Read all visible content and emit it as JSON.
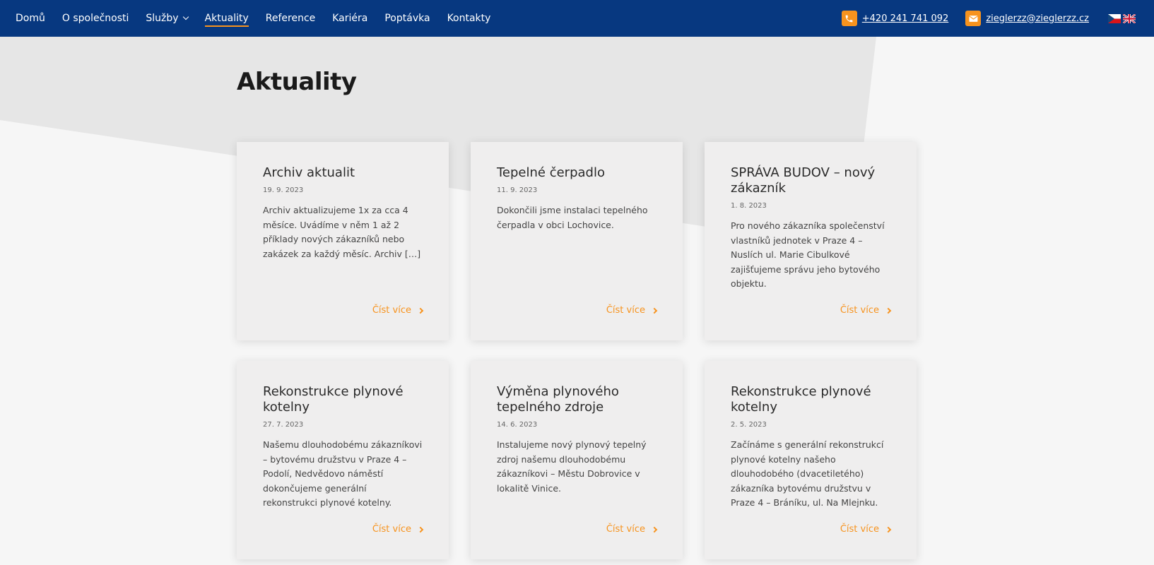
{
  "nav": {
    "items": [
      {
        "label": "Domů",
        "active": false,
        "dropdown": false
      },
      {
        "label": "O společnosti",
        "active": false,
        "dropdown": false
      },
      {
        "label": "Služby",
        "active": false,
        "dropdown": true
      },
      {
        "label": "Aktuality",
        "active": true,
        "dropdown": false
      },
      {
        "label": "Reference",
        "active": false,
        "dropdown": false
      },
      {
        "label": "Kariéra",
        "active": false,
        "dropdown": false
      },
      {
        "label": "Poptávka",
        "active": false,
        "dropdown": false
      },
      {
        "label": "Kontakty",
        "active": false,
        "dropdown": false
      }
    ],
    "phone": "+420 241 741 092",
    "email": "zieglerzz@zieglerzz.cz",
    "languages": [
      "cs",
      "en"
    ]
  },
  "colors": {
    "navbar": "#073880",
    "accent": "#f7931e",
    "background": "#f6f6f6",
    "card": "#efeeee"
  },
  "page": {
    "title": "Aktuality"
  },
  "cards": [
    {
      "title": "Archiv aktualit",
      "date": "19. 9. 2023",
      "text": "Archiv aktualizujeme 1x za cca 4 měsíce. Uvádíme v něm 1 až 2 příklady nových zákazníků nebo zakázek za každý měsíc. Archiv […]",
      "more": "Číst více"
    },
    {
      "title": "Tepelné čerpadlo",
      "date": "11. 9. 2023",
      "text": "Dokončili jsme instalaci tepelného čerpadla v obci Lochovice.",
      "more": "Číst více"
    },
    {
      "title": "SPRÁVA BUDOV – nový zákazník",
      "date": "1. 8. 2023",
      "text": "Pro nového zákazníka společenství vlastníků jednotek v Praze 4 – Nuslích ul. Marie Cibulkové zajišťujeme správu jeho bytového objektu.",
      "more": "Číst více"
    },
    {
      "title": "Rekonstrukce plynové kotelny",
      "date": "27. 7. 2023",
      "text": "Našemu dlouhodobému zákazníkovi  –  bytovému družstvu v Praze 4 – Podolí, Nedvědovo náměstí dokončujeme generální rekonstrukci plynové kotelny.",
      "more": "Číst více"
    },
    {
      "title": "Výměna plynového tepelného zdroje",
      "date": "14. 6. 2023",
      "text": "Instalujeme nový plynový tepelný zdroj našemu dlouhodobému zákazníkovi – Městu Dobrovice v lokalitě Vinice.",
      "more": "Číst více"
    },
    {
      "title": "Rekonstrukce plynové kotelny",
      "date": "2. 5. 2023",
      "text": "Začínáme s generální rekonstrukcí plynové kotelny našeho dlouhodobého (dvacetiletého) zákazníka bytovému družstvu v Praze 4 – Bráníku, ul. Na Mlejnku.",
      "more": "Číst více"
    }
  ]
}
